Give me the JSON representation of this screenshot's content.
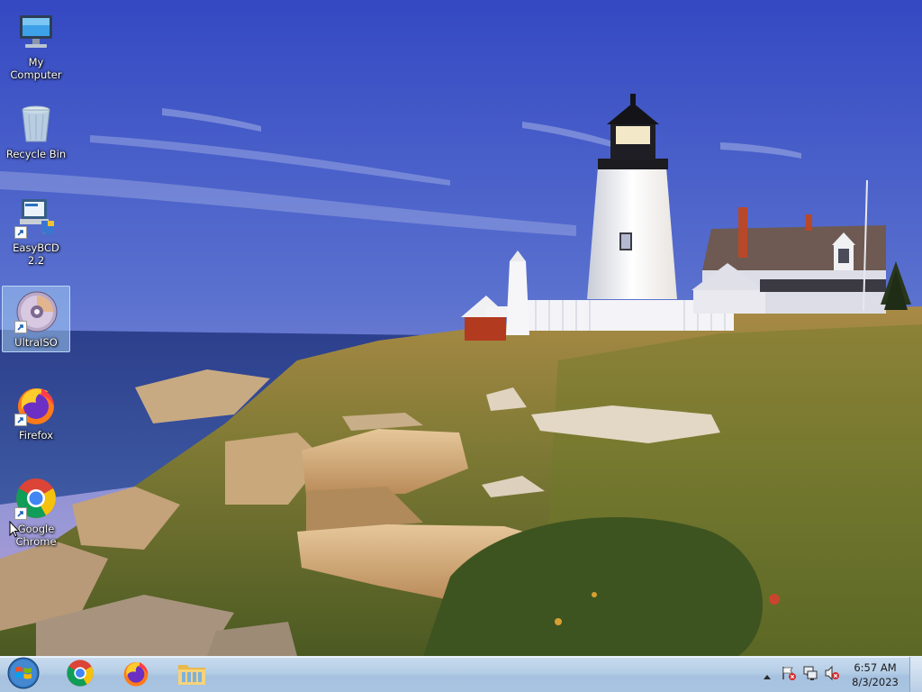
{
  "desktop": {
    "icons": [
      {
        "label": "My Computer",
        "icon": "computer-icon",
        "shortcut": false,
        "selected": false
      },
      {
        "label": "Recycle Bin",
        "icon": "recycle-bin-icon",
        "shortcut": false,
        "selected": false
      },
      {
        "label": "EasyBCD 2.2",
        "icon": "easybcd-icon",
        "shortcut": true,
        "selected": false
      },
      {
        "label": "UltraISO",
        "icon": "ultraiso-disc-icon",
        "shortcut": true,
        "selected": true
      },
      {
        "label": "Firefox",
        "icon": "firefox-icon",
        "shortcut": true,
        "selected": false
      },
      {
        "label": "Google Chrome",
        "icon": "chrome-icon",
        "shortcut": true,
        "selected": false
      }
    ]
  },
  "taskbar": {
    "start_icon": "windows-start-icon",
    "pinned": [
      {
        "icon": "chrome-icon"
      },
      {
        "icon": "firefox-icon"
      },
      {
        "icon": "file-explorer-icon"
      }
    ],
    "tray": {
      "icons": [
        "show-hidden-icons-icon",
        "action-center-flag-icon",
        "network-icon",
        "volume-muted-icon"
      ],
      "time": "6:57 AM",
      "date": "8/3/2023"
    }
  },
  "colors": {
    "taskbar": "#b4cde6",
    "selection": "#a0c8f0",
    "sky_top": "#3b56c6",
    "sea": "#2f4a8a"
  }
}
